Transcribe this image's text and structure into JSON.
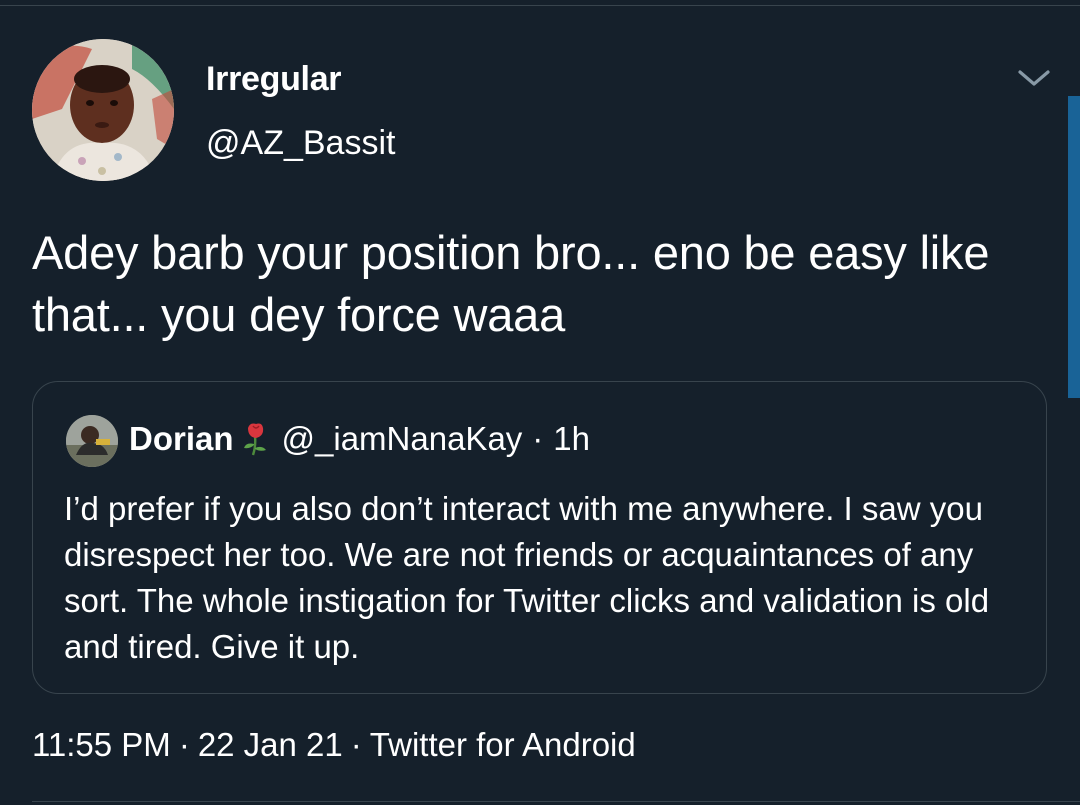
{
  "tweet": {
    "author": {
      "display_name": "Irregular",
      "handle": "@AZ_Bassit",
      "avatar_icon": "baby-photo-avatar"
    },
    "text": "Adey barb your position bro... eno be easy like that... you dey force waaa",
    "timestamp": "11:55 PM",
    "date": "22 Jan 21",
    "source": "Twitter for Android",
    "separator": "·",
    "menu_icon": "chevron-down-icon"
  },
  "quote": {
    "author": {
      "display_name": "Dorian",
      "emoji_icon": "wilted-rose-icon",
      "handle": "@_iamNanaKay",
      "avatar_icon": "user-avatar"
    },
    "separator": "·",
    "time_ago": "1h",
    "text": "I’d prefer if you also don’t interact with me anywhere. I saw you disrespect her too. We are not friends or acquaintances of any sort. The whole instigation for Twitter clicks and validation is old and tired. Give it up."
  },
  "colors": {
    "background": "#15202b",
    "border": "#38444d",
    "text": "#ffffff",
    "scrollbar": "#1d9bf0"
  }
}
